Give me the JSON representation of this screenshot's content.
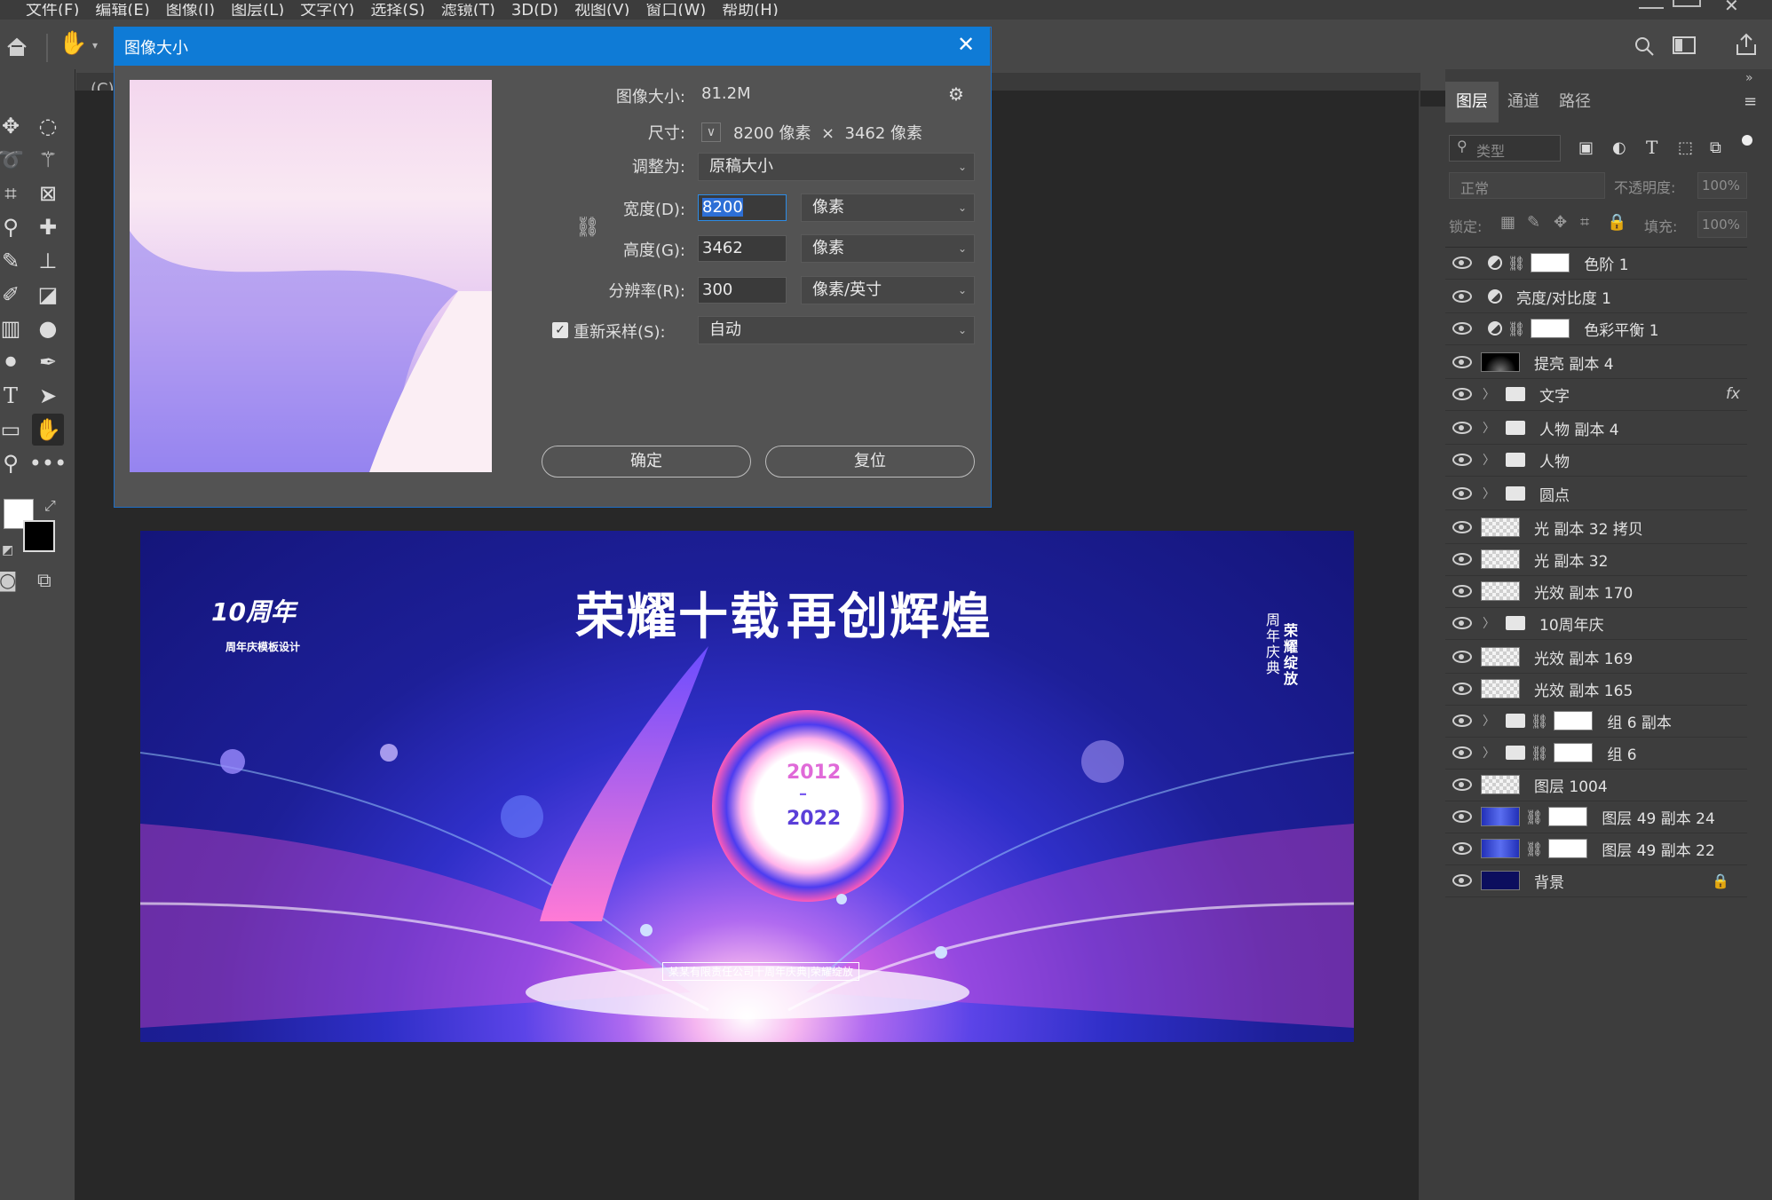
{
  "menu": [
    "文件(F)",
    "编辑(E)",
    "图像(I)",
    "图层(L)",
    "文字(Y)",
    "选择(S)",
    "滤镜(T)",
    "3D(D)",
    "视图(V)",
    "窗口(W)",
    "帮助(H)"
  ],
  "doc_tab_label": "(C)",
  "dialog": {
    "title": "图像大小",
    "size_label": "图像大小:",
    "size_value": "81.2M",
    "dim_label": "尺寸:",
    "dim_value": "8200 像素  ×  3462 像素",
    "fit_label": "调整为:",
    "fit_value": "原稿大小",
    "width_label": "宽度(D):",
    "width_value": "8200",
    "width_unit": "像素",
    "height_label": "高度(G):",
    "height_value": "3462",
    "height_unit": "像素",
    "res_label": "分辨率(R):",
    "res_value": "300",
    "res_unit": "像素/英寸",
    "resample_label": "重新采样(S):",
    "resample_value": "自动",
    "ok_label": "确定",
    "reset_label": "复位"
  },
  "banner": {
    "headline_1": "荣耀十载",
    "headline_2": "再创辉煌",
    "logo_text": "10周年",
    "sub_title": "周年庆模板设计",
    "years_top": "2012",
    "years_dash": "–",
    "years_bottom": "2022",
    "vertical_text_1": "周年庆典",
    "vertical_text_2": "荣耀绽放",
    "footer": "某某有限责任公司十周年庆典|荣耀绽放"
  },
  "panel": {
    "tabs": [
      "图层",
      "通道",
      "路径"
    ],
    "search_placeholder": "类型",
    "blend_mode": "正常",
    "opacity_label": "不透明度:",
    "opacity_value": "100%",
    "lock_label": "锁定:",
    "fill_label": "填充:",
    "fill_value": "100%"
  },
  "layers": [
    {
      "name": "色阶 1",
      "kind": "adjustment-mask"
    },
    {
      "name": "亮度/对比度 1",
      "kind": "adjustment"
    },
    {
      "name": "色彩平衡 1",
      "kind": "adjustment-mask"
    },
    {
      "name": "提亮 副本 4",
      "kind": "dark-thumb"
    },
    {
      "name": "文字",
      "kind": "folder",
      "fx": "fx"
    },
    {
      "name": "人物 副本 4",
      "kind": "folder"
    },
    {
      "name": "人物",
      "kind": "folder"
    },
    {
      "name": "圆点",
      "kind": "folder"
    },
    {
      "name": "光 副本 32 拷贝",
      "kind": "checker"
    },
    {
      "name": "光 副本 32",
      "kind": "checker"
    },
    {
      "name": "光效 副本 170",
      "kind": "checker"
    },
    {
      "name": "10周年庆",
      "kind": "folder"
    },
    {
      "name": "光效 副本 169",
      "kind": "checker"
    },
    {
      "name": "光效 副本 165",
      "kind": "checker"
    },
    {
      "name": "组 6 副本",
      "kind": "folder-mask"
    },
    {
      "name": "组 6",
      "kind": "folder-mask"
    },
    {
      "name": "图层 1004",
      "kind": "checker"
    },
    {
      "name": "图层 49 副本 24",
      "kind": "blue-mask"
    },
    {
      "name": "图层 49 副本 22",
      "kind": "blue-mask"
    },
    {
      "name": "背景",
      "kind": "navy-lock"
    }
  ],
  "colors": {
    "accent": "#0f7bd6",
    "panel": "#3d3d3d",
    "dialog": "#535353"
  }
}
